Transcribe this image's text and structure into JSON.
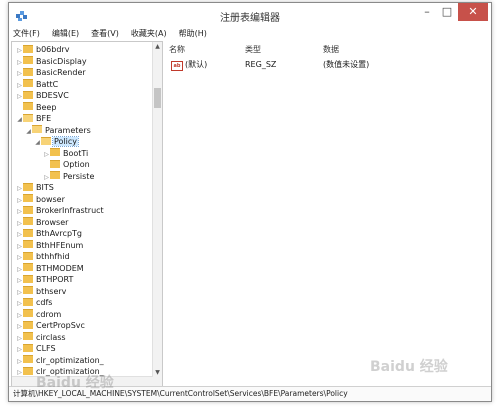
{
  "window": {
    "title": "注册表编辑器",
    "controls": {
      "minimize": "–",
      "maximize": "□",
      "close": "✕"
    }
  },
  "menu": [
    "文件(F)",
    "编辑(E)",
    "查看(V)",
    "收藏夹(A)",
    "帮助(H)"
  ],
  "tree": [
    {
      "label": "b06bdrv",
      "level": 0,
      "expander": "▷"
    },
    {
      "label": "BasicDisplay",
      "level": 0,
      "expander": "▷"
    },
    {
      "label": "BasicRender",
      "level": 0,
      "expander": "▷"
    },
    {
      "label": "BattC",
      "level": 0,
      "expander": "▷"
    },
    {
      "label": "BDESVC",
      "level": 0,
      "expander": "▷"
    },
    {
      "label": "Beep",
      "level": 0,
      "expander": ""
    },
    {
      "label": "BFE",
      "level": 0,
      "expander": "◢"
    },
    {
      "label": "Parameters",
      "level": 1,
      "expander": "◢"
    },
    {
      "label": "Policy",
      "level": 2,
      "expander": "◢",
      "selected": true
    },
    {
      "label": "BootTi",
      "level": 3,
      "expander": "▷"
    },
    {
      "label": "Option",
      "level": 3,
      "expander": ""
    },
    {
      "label": "Persiste",
      "level": 3,
      "expander": "▷"
    },
    {
      "label": "BITS",
      "level": 0,
      "expander": "▷"
    },
    {
      "label": "bowser",
      "level": 0,
      "expander": "▷"
    },
    {
      "label": "BrokerInfrastruct",
      "level": 0,
      "expander": "▷"
    },
    {
      "label": "Browser",
      "level": 0,
      "expander": "▷"
    },
    {
      "label": "BthAvrcpTg",
      "level": 0,
      "expander": "▷"
    },
    {
      "label": "BthHFEnum",
      "level": 0,
      "expander": "▷"
    },
    {
      "label": "bthhfhid",
      "level": 0,
      "expander": "▷"
    },
    {
      "label": "BTHMODEM",
      "level": 0,
      "expander": "▷"
    },
    {
      "label": "BTHPORT",
      "level": 0,
      "expander": "▷"
    },
    {
      "label": "bthserv",
      "level": 0,
      "expander": "▷"
    },
    {
      "label": "cdfs",
      "level": 0,
      "expander": "▷"
    },
    {
      "label": "cdrom",
      "level": 0,
      "expander": "▷"
    },
    {
      "label": "CertPropSvc",
      "level": 0,
      "expander": "▷"
    },
    {
      "label": "circlass",
      "level": 0,
      "expander": "▷"
    },
    {
      "label": "CLFS",
      "level": 0,
      "expander": "▷"
    },
    {
      "label": "clr_optimization_",
      "level": 0,
      "expander": "▷"
    },
    {
      "label": "clr_optimization_",
      "level": 0,
      "expander": "▷"
    }
  ],
  "list": {
    "headers": {
      "name": "名称",
      "type": "类型",
      "data": "数据"
    },
    "rows": [
      {
        "name": "(默认)",
        "type": "REG_SZ",
        "data": "(数值未设置)",
        "icon": "ab"
      }
    ]
  },
  "status": "计算机\\HKEY_LOCAL_MACHINE\\SYSTEM\\CurrentControlSet\\Services\\BFE\\Parameters\\Policy",
  "watermark": "Baidu 经验",
  "colors": {
    "close": "#c7514a",
    "selection": "#cde8ff",
    "folder": "#f2c14e"
  }
}
